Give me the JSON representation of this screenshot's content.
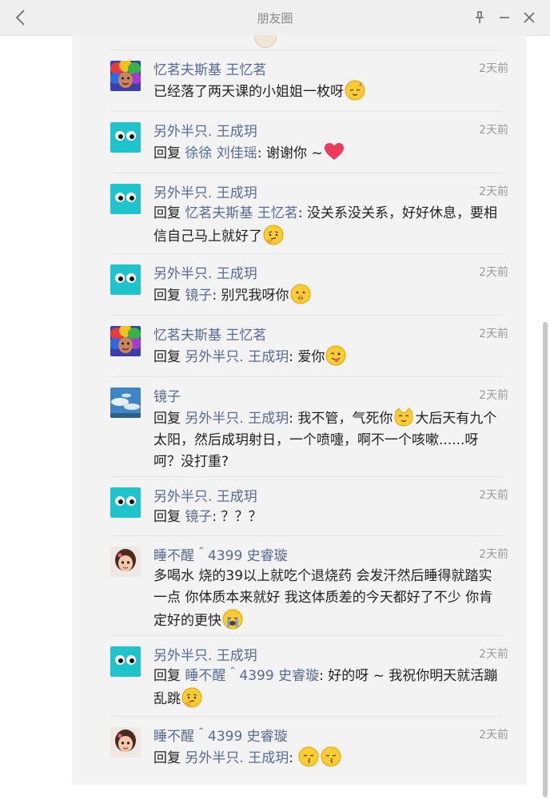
{
  "window": {
    "title": "朋友圈"
  },
  "icons": {
    "back": "chevron-left-icon",
    "pin": "pin-icon",
    "minimize": "minimize-icon",
    "close": "close-icon"
  },
  "avatars": {
    "rainbow-kid": "child with rainbow wig photo",
    "cyan-eyes": "cyan square with two eyes",
    "sky": "blue sky and clouds photo",
    "little-girl": "little girl photo"
  },
  "comments": [
    {
      "user": "忆茗夫斯基 王忆茗",
      "time": "2天前",
      "avatar": "rainbow-kid",
      "text": "已经落了两天课的小姐姐一枚呀",
      "emoji": "sleepy-face-emoji"
    },
    {
      "user": "另外半只. 王成玥",
      "time": "2天前",
      "avatar": "cyan-eyes",
      "reply_prefix": "回复",
      "reply_to": "徐徐 刘佳瑶",
      "text": ": 谢谢你 ~",
      "emoji": "heart-emoji"
    },
    {
      "user": "另外半只. 王成玥",
      "time": "2天前",
      "avatar": "cyan-eyes",
      "reply_prefix": "回复",
      "reply_to": "忆茗夫斯基 王忆茗",
      "text": ": 没关系没关系，好好休息，要相信自己马上就好了",
      "emoji": "thinking-face-emoji"
    },
    {
      "user": "另外半只. 王成玥",
      "time": "2天前",
      "avatar": "cyan-eyes",
      "reply_prefix": "回复",
      "reply_to": "镜子",
      "text": ": 别咒我呀你",
      "emoji": "shushing-face-emoji"
    },
    {
      "user": "忆茗夫斯基 王忆茗",
      "time": "2天前",
      "avatar": "rainbow-kid",
      "reply_prefix": "回复",
      "reply_to": "另外半只. 王成玥",
      "text": ": 爱你",
      "emoji": "winking-tongue-emoji"
    },
    {
      "user": "镜子",
      "time": "2天前",
      "avatar": "sky",
      "reply_prefix": "回复",
      "reply_to": "另外半只. 王成玥",
      "text": ": 我不管，气死你",
      "emoji": "cat-face-emoji",
      "text2": "大后天有九个太阳，然后成玥射日，一个喷嚏，啊不一个咳嗽......呀呵？没打重?"
    },
    {
      "user": "另外半只. 王成玥",
      "time": "2天前",
      "avatar": "cyan-eyes",
      "reply_prefix": "回复",
      "reply_to": "镜子",
      "text": ": ？？？"
    },
    {
      "user": "睡不醒＾4399 史睿璇",
      "time": "2天前",
      "avatar": "little-girl",
      "text": "多喝水 烧的39以上就吃个退烧药 会发汗然后睡得就踏实一点 你体质本来就好 我这体质差的今天都好了不少 你肯定好的更快",
      "emoji": "crying-face-emoji"
    },
    {
      "user": "另外半只. 王成玥",
      "time": "2天前",
      "avatar": "cyan-eyes",
      "reply_prefix": "回复",
      "reply_to": "睡不醒＾4399 史睿璇",
      "text": ": 好的呀 ~ 我祝你明天就活蹦乱跳",
      "emoji": "thinking-face-emoji"
    },
    {
      "user": "睡不醒＾4399 史睿璇",
      "time": "2天前",
      "avatar": "little-girl",
      "reply_prefix": "回复",
      "reply_to": "另外半只. 王成玥",
      "text": ":",
      "emoji": "kissing-face-emoji",
      "emoji2": "kissing-face-emoji"
    }
  ]
}
